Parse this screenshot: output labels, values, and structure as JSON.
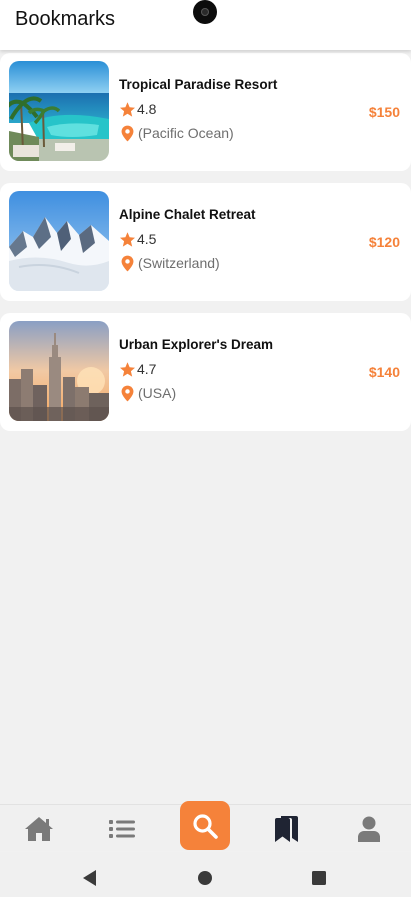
{
  "header": {
    "title": "Bookmarks"
  },
  "bookmarks": [
    {
      "title": "Tropical Paradise Resort",
      "rating": "4.8",
      "location": "(Pacific Ocean)",
      "price": "$150"
    },
    {
      "title": "Alpine Chalet Retreat",
      "rating": "4.5",
      "location": "(Switzerland)",
      "price": "$120"
    },
    {
      "title": "Urban Explorer's Dream",
      "rating": "4.7",
      "location": "(USA)",
      "price": "$140"
    }
  ],
  "colors": {
    "accent": "#f5823a",
    "nav_icon": "#7a7a7a",
    "nav_active": "#1f2433"
  },
  "bottom_nav": {
    "items": [
      {
        "icon": "home-icon"
      },
      {
        "icon": "list-icon"
      },
      {
        "icon": "search-icon",
        "selected": true
      },
      {
        "icon": "bookmarks-icon",
        "active": true
      },
      {
        "icon": "profile-icon"
      }
    ]
  },
  "system_nav": {
    "items": [
      "back-icon",
      "home-circle-icon",
      "recents-icon"
    ]
  }
}
